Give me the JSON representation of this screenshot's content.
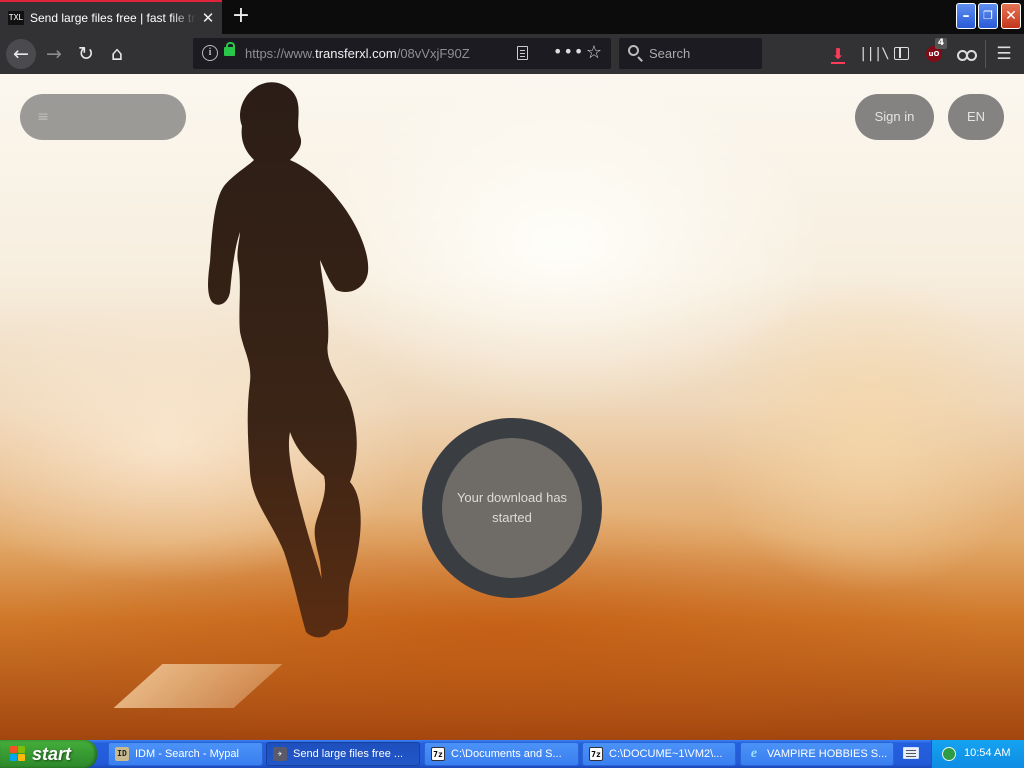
{
  "browser": {
    "tab": {
      "favicon_text": "TXL",
      "title": "Send large files free | fast file transfer",
      "close_glyph": "✕"
    },
    "new_tab_glyph": "+",
    "window_controls": {
      "minimize": "–",
      "maximize": "❐",
      "close": "✕"
    },
    "nav": {
      "back_glyph": "←",
      "forward_glyph": "→",
      "reload_glyph": "↻",
      "home_glyph": "⌂"
    },
    "url": {
      "scheme": "https://www.",
      "domain": "transferxl.com",
      "path": "/08vVxjF90Z"
    },
    "url_more_glyph": "•••",
    "bookmark_glyph": "☆",
    "search": {
      "placeholder": "Search"
    },
    "toolbar": {
      "download_glyph": "⬇",
      "library_glyph": "|||\\",
      "menu_glyph": "☰",
      "ublock_label": "uO",
      "ublock_badge": "4"
    }
  },
  "page": {
    "sign_in_label": "Sign in",
    "language_label": "EN",
    "menu_glyph": "≡",
    "download_status": "Your download has started"
  },
  "taskbar": {
    "start_label": "start",
    "tasks": [
      {
        "icon": "idm",
        "label": "IDM - Search - Mypal"
      },
      {
        "icon": "firefox",
        "label": "Send large files free ..."
      },
      {
        "icon": "7z",
        "label": "C:\\Documents and S..."
      },
      {
        "icon": "7z",
        "label": "C:\\DOCUME~1\\VM2\\..."
      },
      {
        "icon": "ie",
        "label": "VAMPIRE HOBBIES S..."
      }
    ],
    "task_icon_text": {
      "idm": "ID",
      "firefox": "✈",
      "7z": "7z",
      "ie": "e"
    },
    "clock": "10:54 AM"
  },
  "colors": {
    "tab_accent": "#e0223b",
    "browser_chrome": "#323234",
    "download_arrow": "#ff3b5c",
    "taskbar_blue": "#235ad8",
    "start_green": "#3a9e34"
  }
}
